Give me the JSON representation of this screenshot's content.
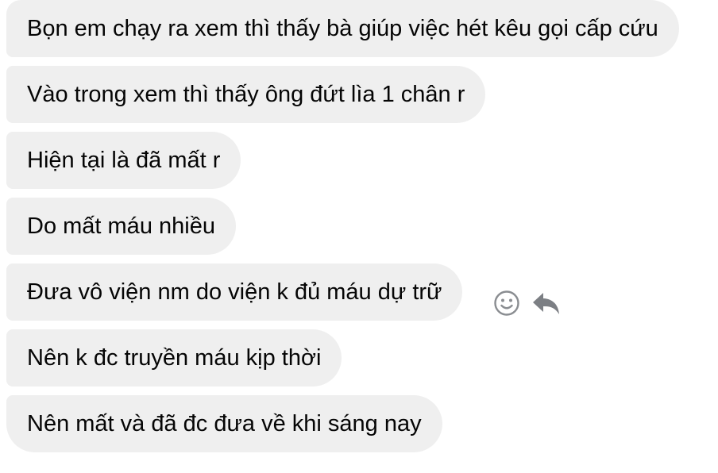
{
  "messages": [
    {
      "text": "Bọn em chạy ra xem thì thấy bà giúp việc hét kêu gọi cấp cứu"
    },
    {
      "text": "Vào trong xem thì thấy ông đứt lìa 1 chân r"
    },
    {
      "text": "Hiện tại là đã mất r"
    },
    {
      "text": "Do mất máu nhiều"
    },
    {
      "text": "Đưa vô viện nm do viện k đủ máu dự trữ"
    },
    {
      "text": "Nên k đc truyền máu kịp thời"
    },
    {
      "text": "Nên mất và đã đc đưa về khi sáng nay"
    }
  ],
  "hover_actions": {
    "icons": [
      "smiley-icon",
      "reply-icon"
    ],
    "color": "#8a8d91"
  },
  "colors": {
    "bubble_bg": "#efefef",
    "text": "#050505"
  }
}
